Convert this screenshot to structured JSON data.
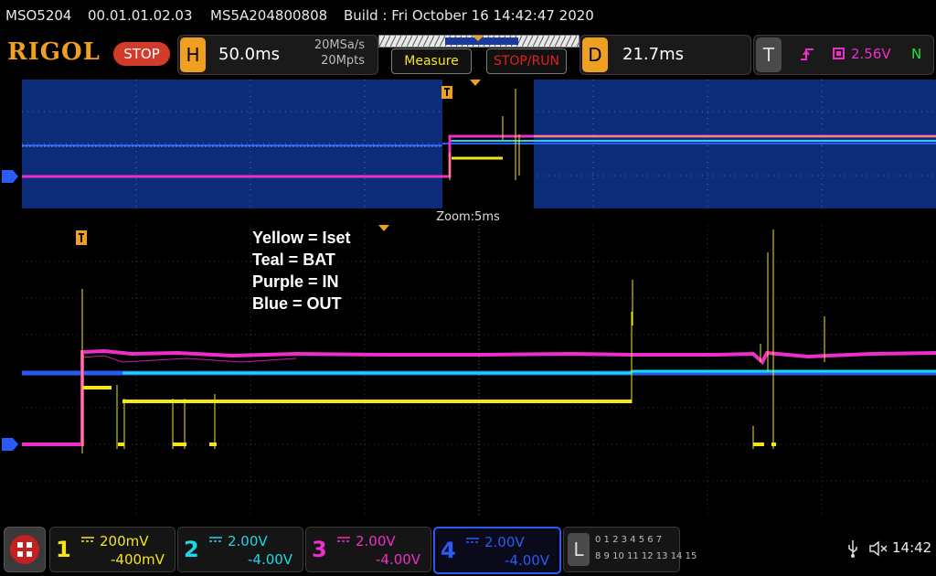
{
  "status": {
    "model": "MSO5204",
    "firmware": "00.01.01.02.03",
    "serial": "MS5A204800808",
    "build": "Build : Fri October 16 14:42:47 2020"
  },
  "toolbar": {
    "logo": "RIGOL",
    "run_state": "STOP",
    "h_key": "H",
    "timebase": "50.0ms",
    "sample_rate": "20MSa/s",
    "mem_depth": "20Mpts",
    "measure_label": "Measure",
    "stoprun_label": "STOP/RUN",
    "d_key": "D",
    "delay": "21.7ms",
    "t_key": "T",
    "trigger_level": "2.56V",
    "trigger_mode": "N"
  },
  "zoom": {
    "label": "Zoom:5ms"
  },
  "legend": {
    "line1": "Yellow = Iset",
    "line2": "Teal = BAT",
    "line3": "Purple = IN",
    "line4": "Blue = OUT"
  },
  "channels": [
    {
      "num": "1",
      "scale": "200mV",
      "offset": "-400mV",
      "color": "#f5e616"
    },
    {
      "num": "2",
      "scale": "2.00V",
      "offset": "-4.00V",
      "color": "#19d8e8"
    },
    {
      "num": "3",
      "scale": "2.00V",
      "offset": "-4.00V",
      "color": "#ee2ec8"
    },
    {
      "num": "4",
      "scale": "2.00V",
      "offset": "-4.00V",
      "color": "#2a5cf5"
    }
  ],
  "logic": {
    "key": "L",
    "row1": "0 1 2 3  4 5 6 7",
    "row2": "8 9 10 11 12 13 14 15"
  },
  "system": {
    "time": "14:42"
  },
  "colors": {
    "yellow": "#f5e616",
    "teal": "#19d8e8",
    "purple": "#ee2ec8",
    "blue": "#2a5cf5",
    "orange": "#f0a020"
  }
}
